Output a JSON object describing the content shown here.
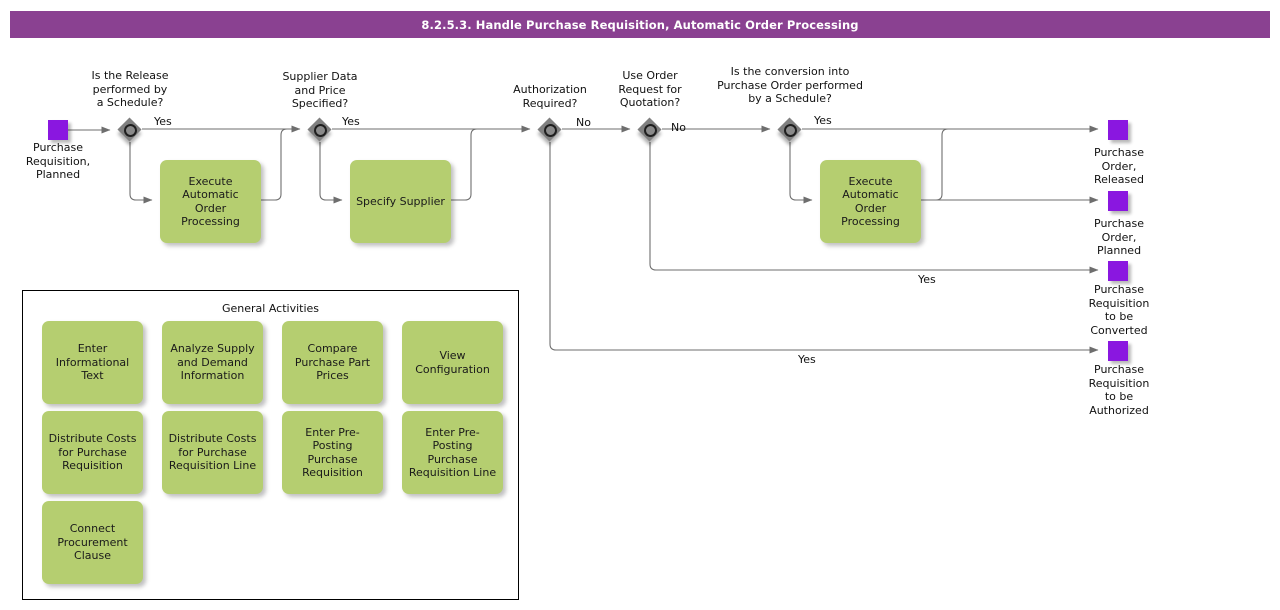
{
  "header": {
    "title": "8.2.5.3. Handle Purchase Requisition, Automatic Order Processing",
    "bar_color": "#8A4191",
    "text_color": "#FFFFFF"
  },
  "palette": {
    "event": "#8A17E0",
    "activity": "#B5CE70",
    "gateway": "#808080",
    "connector": "#6E6E6E",
    "panel_border": "#000000"
  },
  "diagram": {
    "type": "bpmn-process-flow",
    "start_events": [
      {
        "id": "start1",
        "label": "Purchase\nRequisition,\nPlanned",
        "icon": "purple-square-event"
      }
    ],
    "gateways": [
      {
        "id": "gw1",
        "label": "Is the Release\nperformed by\na Schedule?",
        "icon": "gateway-diamond"
      },
      {
        "id": "gw2",
        "label": "Supplier Data\nand Price\nSpecified?",
        "icon": "gateway-diamond"
      },
      {
        "id": "gw3",
        "label": "Authorization\nRequired?",
        "icon": "gateway-diamond"
      },
      {
        "id": "gw4",
        "label": "Use Order\nRequest for\nQuotation?",
        "icon": "gateway-diamond"
      },
      {
        "id": "gw5",
        "label": "Is the conversion into\nPurchase Order performed\nby a Schedule?",
        "icon": "gateway-diamond"
      }
    ],
    "activities": [
      {
        "id": "act1",
        "label": "Execute\nAutomatic Order\nProcessing"
      },
      {
        "id": "act2",
        "label": "Specify Supplier"
      },
      {
        "id": "act3",
        "label": "Execute\nAutomatic Order\nProcessing"
      }
    ],
    "end_events": [
      {
        "id": "end1",
        "label": "Purchase\nOrder,\nReleased",
        "icon": "purple-square-event"
      },
      {
        "id": "end2",
        "label": "Purchase\nOrder,\nPlanned",
        "icon": "purple-square-event"
      },
      {
        "id": "end3",
        "label": "Purchase\nRequisition\nto be\nConverted",
        "icon": "purple-square-event"
      },
      {
        "id": "end4",
        "label": "Purchase\nRequisition\nto be\nAuthorized",
        "icon": "purple-square-event"
      }
    ],
    "edge_labels": [
      {
        "id": "e1",
        "text": "Yes"
      },
      {
        "id": "e2",
        "text": "Yes"
      },
      {
        "id": "e3",
        "text": "No"
      },
      {
        "id": "e4",
        "text": "No"
      },
      {
        "id": "e5",
        "text": "Yes"
      },
      {
        "id": "e6",
        "text": "Yes"
      },
      {
        "id": "e7",
        "text": "Yes"
      }
    ]
  },
  "general_activities": {
    "title": "General Activities",
    "items": [
      {
        "label": "Enter\nInformational\nText"
      },
      {
        "label": "Analyze Supply\nand Demand\nInformation"
      },
      {
        "label": "Compare\nPurchase Part\nPrices"
      },
      {
        "label": "View\nConfiguration"
      },
      {
        "label": "Distribute Costs\nfor Purchase\nRequisition"
      },
      {
        "label": "Distribute Costs\nfor Purchase\nRequisition Line"
      },
      {
        "label": "Enter Pre-\nPosting\nPurchase\nRequisition"
      },
      {
        "label": "Enter Pre-\nPosting\nPurchase\nRequisition Line"
      },
      {
        "label": "Connect\nProcurement\nClause"
      }
    ]
  }
}
